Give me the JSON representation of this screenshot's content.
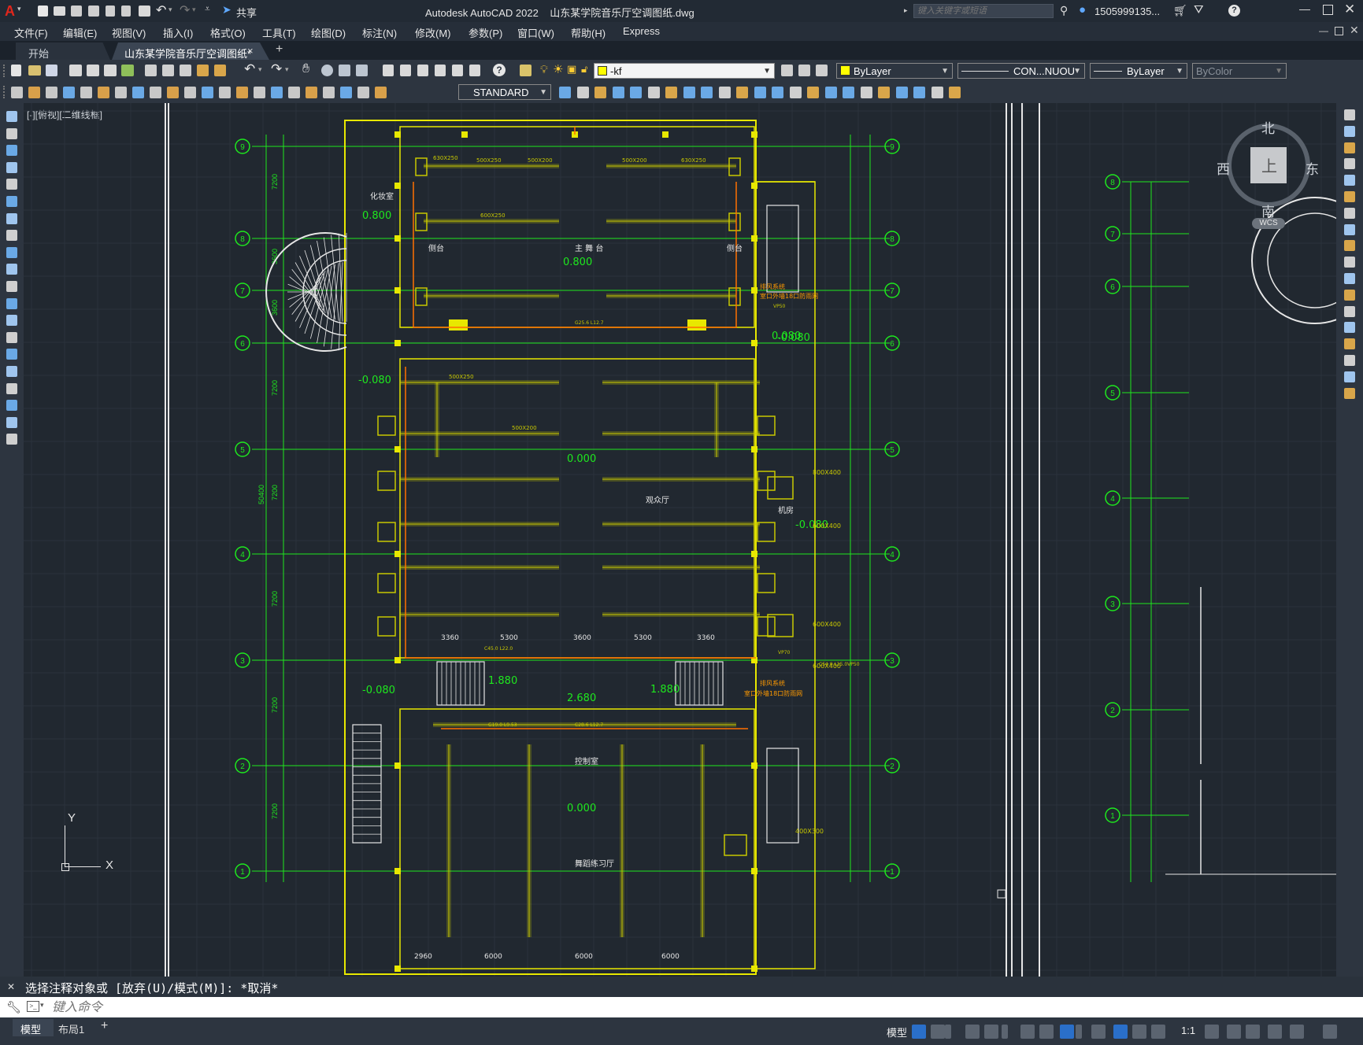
{
  "window": {
    "app_title": "Autodesk AutoCAD 2022",
    "file_title": "山东某学院音乐厅空调图纸.dwg",
    "share_label": "共享",
    "search_placeholder": "键入关键字或短语",
    "user_name": "1505999135...",
    "help_label": "?"
  },
  "menu": [
    "文件(F)",
    "编辑(E)",
    "视图(V)",
    "插入(I)",
    "格式(O)",
    "工具(T)",
    "绘图(D)",
    "标注(N)",
    "修改(M)",
    "参数(P)",
    "窗口(W)",
    "帮助(H)",
    "Express"
  ],
  "tabs": {
    "start": "开始",
    "document": "山东某学院音乐厅空调图纸*",
    "close": "×",
    "add": "+"
  },
  "properties": {
    "layer": "-kf",
    "color": "ByLayer",
    "linetype": "CON...NUOU",
    "lineweight": "ByLayer",
    "plotstyle": "ByColor",
    "textstyle": "STANDARD"
  },
  "viewport": {
    "label": "[-][俯视][二维线框]",
    "viewcube_north": "北",
    "viewcube_south": "南",
    "viewcube_east": "东",
    "viewcube_west": "西",
    "viewcube_top": "上",
    "wcs": "WCS",
    "ucs_x": "X",
    "ucs_y": "Y"
  },
  "drawing": {
    "grid_left": [
      "9",
      "8",
      "7",
      "6",
      "5",
      "4",
      "3",
      "2",
      "1"
    ],
    "grid_right_far": [
      "8",
      "7",
      "6",
      "5",
      "4",
      "3",
      "2",
      "1"
    ],
    "dims": [
      "7200",
      "3600",
      "3600",
      "7200",
      "7200",
      "7200",
      "7200",
      "7200",
      "50400"
    ],
    "rooms": {
      "stage": "主 舞 台",
      "side_left": "侧台",
      "side_right": "侧台",
      "hall": "观众厅",
      "control": "控制室",
      "rehearsal": "舞蹈练习厅",
      "makeup": "化妆室",
      "machine": "机房"
    },
    "levels": [
      "0.800",
      "0.800",
      "-0.080",
      "-0.080",
      "0.000",
      "-0.080",
      "1.880",
      "2.680",
      "1.880",
      "-0.080",
      "0.000",
      "0.080"
    ],
    "duct_labels": [
      "500X250",
      "500X200",
      "630X250",
      "600X250",
      "500X200",
      "630X250",
      "500X250",
      "500X200"
    ],
    "duct_large": [
      "800X400",
      "600X400",
      "600X400",
      "600X400",
      "400X300"
    ],
    "spans": [
      "3360",
      "5300",
      "3600",
      "5300",
      "3360",
      "6000",
      "6000",
      "6000",
      "2960"
    ],
    "pipe_labels": [
      "G25.6 L12.7",
      "C45.0 L22.0",
      "VP50",
      "VP70",
      "C54.0 L25.0VP50",
      "C28.6 L12.7",
      "G19.0 L9.53"
    ],
    "notes": [
      "排风系统",
      "室口外墙18口防雨网"
    ]
  },
  "command": {
    "history": "选择注释对象或 [放弃(U)/模式(M)]: *取消*",
    "placeholder": "键入命令"
  },
  "status": {
    "model_tab": "模型",
    "layout_tab": "布局1",
    "add_layout": "+",
    "model_label": "模型",
    "scale": "1:1"
  },
  "colors": {
    "accent": "#2a6fc9",
    "drawing_bg": "#212830",
    "wall": "#e8e800",
    "grid_line": "#1ee81e",
    "duct": "#c8c800",
    "pipe": "#ff7000"
  }
}
